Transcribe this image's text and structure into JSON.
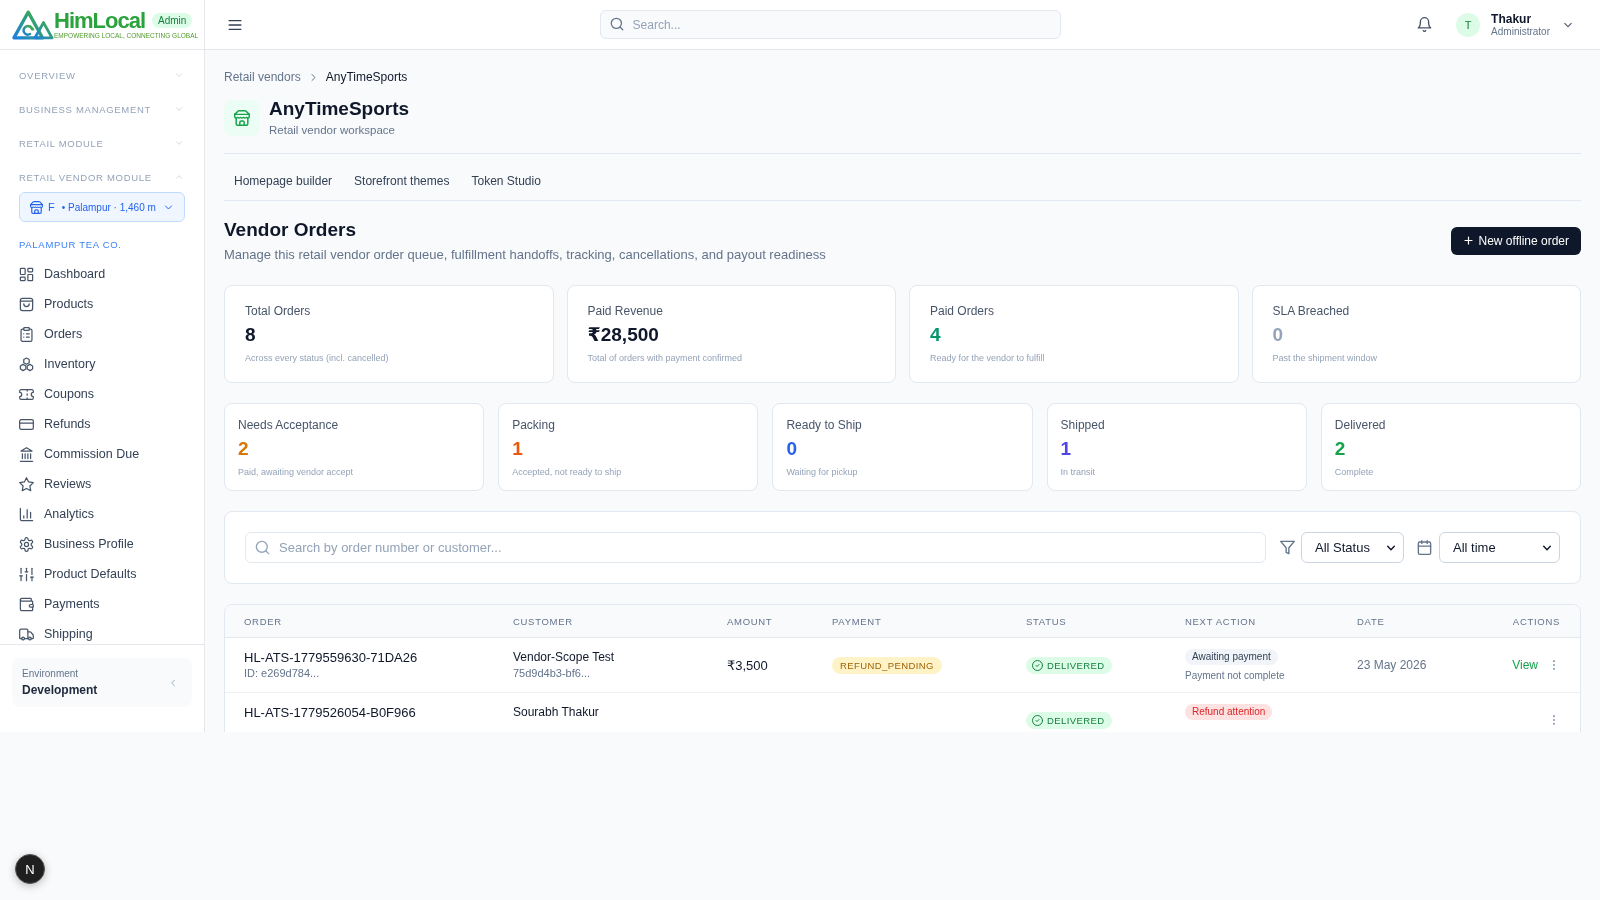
{
  "sidebar": {
    "brand": {
      "name": "HimLocal",
      "tagline": "EMPOWERING LOCAL, CONNECTING GLOBAL",
      "badge": "Admin"
    },
    "sections": [
      {
        "label": "OVERVIEW",
        "expanded": false
      },
      {
        "label": "BUSINESS MANAGEMENT",
        "expanded": false
      },
      {
        "label": "RETAIL MODULE",
        "expanded": false
      },
      {
        "label": "RETAIL VENDOR MODULE",
        "expanded": true,
        "vendor_picker": {
          "name": "F",
          "detail": "• Palampur · 1,460 m"
        },
        "group_label": "PALAMPUR TEA CO.",
        "items": [
          {
            "label": "Dashboard",
            "selected": false
          },
          {
            "label": "Products",
            "selected": false
          },
          {
            "label": "Orders",
            "selected": false
          },
          {
            "label": "Inventory",
            "selected": false
          },
          {
            "label": "Coupons",
            "selected": false
          },
          {
            "label": "Refunds",
            "selected": false
          },
          {
            "label": "Commission Due",
            "selected": false
          },
          {
            "label": "Reviews",
            "selected": false
          },
          {
            "label": "Analytics",
            "selected": false
          },
          {
            "label": "Business Profile",
            "selected": false
          },
          {
            "label": "Product Defaults",
            "selected": false
          },
          {
            "label": "Payments",
            "selected": false
          },
          {
            "label": "Shipping",
            "selected": false
          }
        ]
      }
    ],
    "environment": {
      "label": "Environment",
      "value": "Development"
    }
  },
  "topbar": {
    "search": {
      "placeholder": "Search..."
    },
    "user": {
      "initial": "T",
      "name": "Thakur",
      "role": "Administrator"
    }
  },
  "breadcrumb": [
    "Retail vendors",
    "AnyTimeSports"
  ],
  "vendor": {
    "name": "AnyTimeSports",
    "subtitle": "Retail vendor workspace"
  },
  "tabs": [
    {
      "label": "Homepage builder",
      "selected": false
    },
    {
      "label": "Storefront themes",
      "selected": false
    },
    {
      "label": "Token Studio",
      "selected": false
    }
  ],
  "page": {
    "title": "Vendor Orders",
    "description": "Manage this retail vendor order queue, fulfillment handoffs, tracking, cancellations, and payout readiness",
    "action": "New offline order"
  },
  "summary_cards": [
    {
      "label": "Total Orders",
      "value": "8",
      "caption": "Across every status (incl. cancelled)",
      "color": "#0f172a"
    },
    {
      "label": "Paid Revenue",
      "value": "₹28,500",
      "caption": "Total of orders with payment confirmed",
      "color": "#0f172a"
    },
    {
      "label": "Paid Orders",
      "value": "4",
      "caption": "Ready for the vendor to fulfill",
      "color": "#059669"
    },
    {
      "label": "SLA Breached",
      "value": "0",
      "caption": "Past the shipment window",
      "color": "#94a3b8"
    }
  ],
  "status_cards": [
    {
      "label": "Needs Acceptance",
      "value": "2",
      "caption": "Paid, awaiting vendor accept",
      "color": "#d97706"
    },
    {
      "label": "Packing",
      "value": "1",
      "caption": "Accepted, not ready to ship",
      "color": "#ea580c"
    },
    {
      "label": "Ready to Ship",
      "value": "0",
      "caption": "Waiting for pickup",
      "color": "#2563eb"
    },
    {
      "label": "Shipped",
      "value": "1",
      "caption": "In transit",
      "color": "#4f46e5"
    },
    {
      "label": "Delivered",
      "value": "2",
      "caption": "Complete",
      "color": "#16a34a"
    }
  ],
  "filters": {
    "search": {
      "placeholder": "Search by order number or customer..."
    },
    "status": "All Status",
    "period": "All time"
  },
  "table": {
    "columns": [
      "ORDER",
      "CUSTOMER",
      "AMOUNT",
      "PAYMENT",
      "STATUS",
      "NEXT ACTION",
      "DATE",
      "ACTIONS"
    ],
    "rows": [
      {
        "order": "HL-ATS-1779559630-71DA26",
        "order_id": "ID: e269d784...",
        "customer": "Vendor-Scope Test",
        "customer_id": "75d9d4b3-bf6...",
        "amount": "₹3,500",
        "payment": {
          "label": "REFUND_PENDING",
          "kind": "warning"
        },
        "status": {
          "label": "DELIVERED",
          "kind": "success"
        },
        "next_action": {
          "label": "Awaiting payment",
          "kind": "neutral",
          "note": "Payment not complete"
        },
        "date": "23 May 2026",
        "action": "View"
      },
      {
        "order": "HL-ATS-1779526054-B0F966",
        "customer": "Sourabh Thakur",
        "status": {
          "label": "DELIVERED",
          "kind": "success"
        },
        "next_action": {
          "label": "Refund attention",
          "kind": "danger"
        }
      }
    ]
  },
  "dev_indicator": {
    "label": "N"
  }
}
